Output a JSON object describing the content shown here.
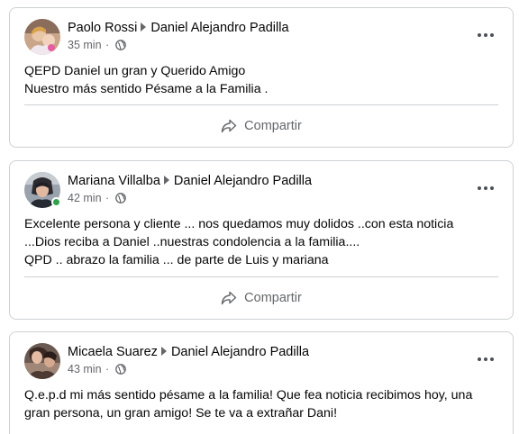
{
  "posts": [
    {
      "author": "Paolo Rossi",
      "target": "Daniel Alejandro Padilla",
      "time": "35 min",
      "dot": "·",
      "lines": [
        "QEPD Daniel un gran y Querido Amigo",
        "Nuestro más sentido Pésame a la Familia ."
      ],
      "share_label": "Compartir"
    },
    {
      "author": "Mariana Villalba",
      "target": "Daniel Alejandro Padilla",
      "time": "42 min",
      "dot": "·",
      "lines": [
        "Excelente persona y cliente ... nos quedamos muy dolidos ..con esta noticia",
        "...Dios reciba a Daniel ..nuestras condolencia a la familia....",
        "QPD .. abrazo la familia ... de parte de Luis y mariana"
      ],
      "share_label": "Compartir"
    },
    {
      "author": "Micaela Suarez",
      "target": "Daniel Alejandro Padilla",
      "time": "43 min",
      "dot": "·",
      "lines": [
        "Q.e.p.d mi más sentido pésame a la familia! Que fea noticia recibimos hoy, una",
        "gran persona, un gran amigo! Se te va a extrañar Dani!"
      ]
    }
  ],
  "icons": {
    "privacy": "globe-icon",
    "share": "share-arrow-icon",
    "more": "more-options-icon",
    "online": "online-status-icon"
  },
  "colors": {
    "secondary_text": "#65676b",
    "border": "#ced0d4",
    "online": "#31a24c"
  }
}
